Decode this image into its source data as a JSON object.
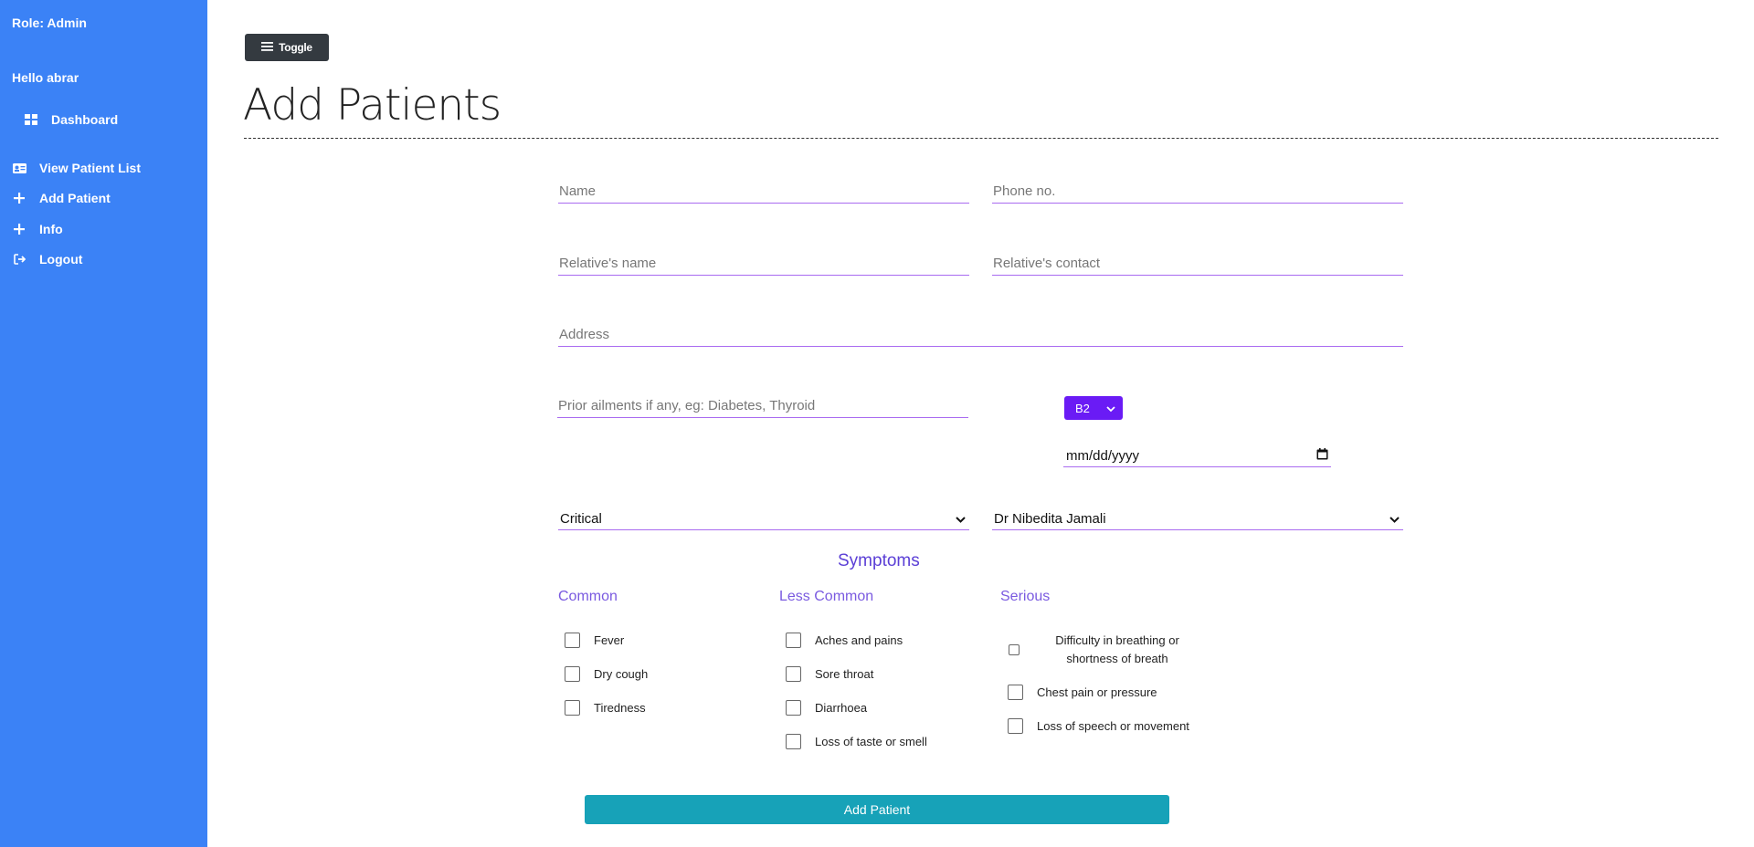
{
  "sidebar": {
    "role": "Role: Admin",
    "greeting": "Hello abrar",
    "items": [
      {
        "label": "Dashboard",
        "icon": "dashboard-icon"
      },
      {
        "label": "View Patient List",
        "icon": "id-card-icon"
      },
      {
        "label": "Add Patient",
        "icon": "plus-icon"
      },
      {
        "label": "Info",
        "icon": "plus-icon"
      },
      {
        "label": "Logout",
        "icon": "logout-icon"
      }
    ]
  },
  "toolbar": {
    "toggle_label": "Toggle"
  },
  "page": {
    "title": "Add Patients"
  },
  "form": {
    "name_placeholder": "Name",
    "phone_placeholder": "Phone no.",
    "relative_name_placeholder": "Relative's name",
    "relative_contact_placeholder": "Relative's contact",
    "address_placeholder": "Address",
    "prior_ailments_placeholder": "Prior ailments if any, eg: Diabetes, Thyroid",
    "blood_group": "B2",
    "date_placeholder": "mm/dd/yyyy",
    "status": "Critical",
    "doctor": "Dr Nibedita Jamali",
    "submit_label": "Add Patient"
  },
  "symptoms": {
    "title": "Symptoms",
    "common": {
      "heading": "Common",
      "items": [
        "Fever",
        "Dry cough",
        "Tiredness"
      ]
    },
    "less_common": {
      "heading": "Less Common",
      "items": [
        "Aches and pains",
        "Sore throat",
        "Diarrhoea",
        "Loss of taste or smell"
      ]
    },
    "serious": {
      "heading": "Serious",
      "items": [
        "Difficulty in breathing or shortness of breath",
        "Chest pain or pressure",
        "Loss of speech or movement"
      ]
    }
  },
  "colors": {
    "sidebar": "#3b82f6",
    "accent": "#6a1bf5",
    "underline": "#a96bf0",
    "submit": "#17a2b8",
    "toggle": "#343a40"
  }
}
